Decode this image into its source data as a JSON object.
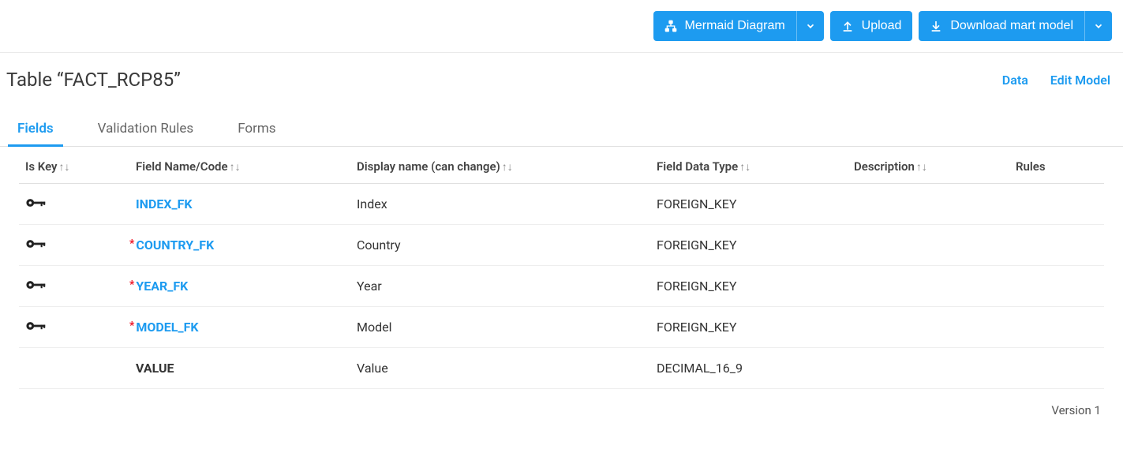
{
  "toolbar": {
    "mermaid_label": "Mermaid Diagram",
    "upload_label": "Upload",
    "download_label": "Download mart model"
  },
  "header": {
    "title": "Table “FACT_RCP85”",
    "data_link": "Data",
    "edit_link": "Edit Model"
  },
  "tabs": {
    "fields": "Fields",
    "validation": "Validation Rules",
    "forms": "Forms"
  },
  "columns": {
    "is_key": "Is Key",
    "field_name": "Field Name/Code",
    "display_name": "Display name (can change)",
    "data_type": "Field Data Type",
    "description": "Description",
    "rules": "Rules"
  },
  "rows": [
    {
      "is_key": true,
      "required": false,
      "name": "INDEX_FK",
      "link": true,
      "display": "Index",
      "type": "FOREIGN_KEY",
      "description": "",
      "rules": ""
    },
    {
      "is_key": true,
      "required": true,
      "name": "COUNTRY_FK",
      "link": true,
      "display": "Country",
      "type": "FOREIGN_KEY",
      "description": "",
      "rules": ""
    },
    {
      "is_key": true,
      "required": true,
      "name": "YEAR_FK",
      "link": true,
      "display": "Year",
      "type": "FOREIGN_KEY",
      "description": "",
      "rules": ""
    },
    {
      "is_key": true,
      "required": true,
      "name": "MODEL_FK",
      "link": true,
      "display": "Model",
      "type": "FOREIGN_KEY",
      "description": "",
      "rules": ""
    },
    {
      "is_key": false,
      "required": false,
      "name": "VALUE",
      "link": false,
      "display": "Value",
      "type": "DECIMAL_16_9",
      "description": "",
      "rules": ""
    }
  ],
  "footer": {
    "version": "Version 1"
  }
}
